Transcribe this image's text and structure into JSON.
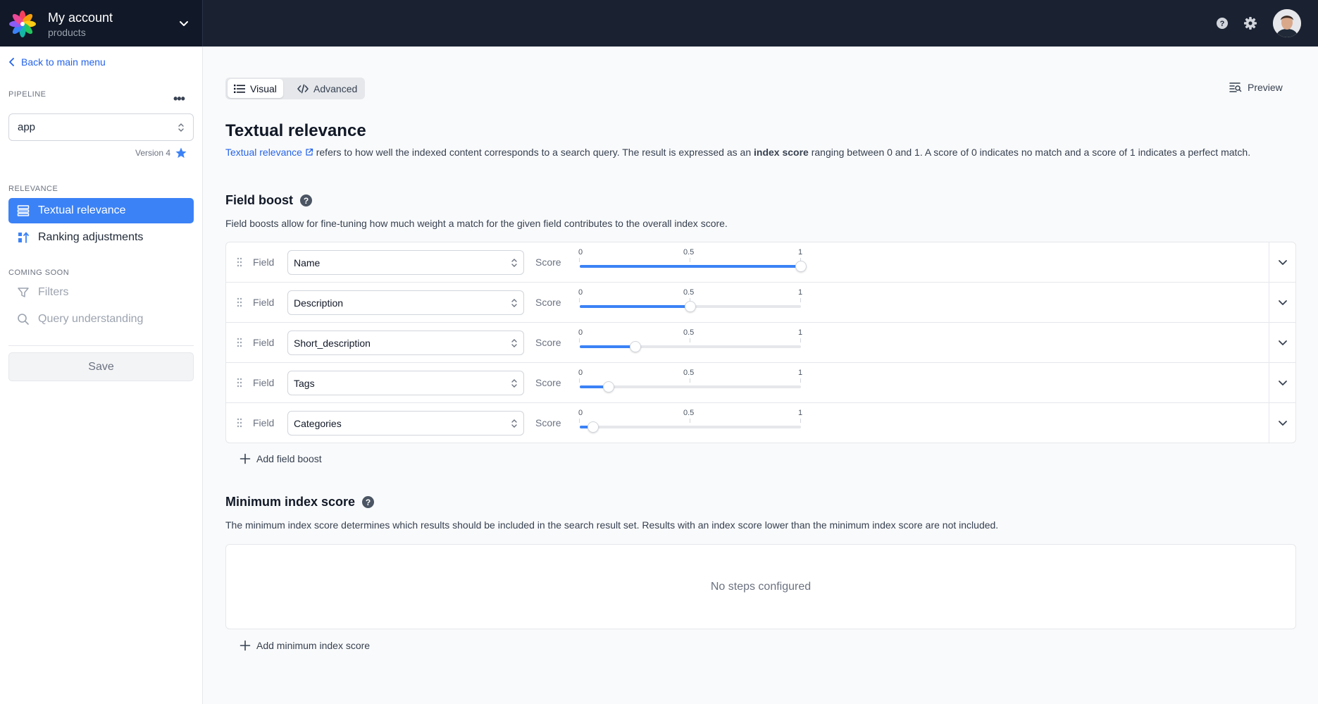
{
  "header": {
    "account_title": "My account",
    "account_subtitle": "products"
  },
  "sidebar": {
    "back_label": "Back to main menu",
    "pipeline_label": "PIPELINE",
    "pipeline_value": "app",
    "version_label": "Version 4",
    "relevance_label": "RELEVANCE",
    "relevance_items": [
      {
        "label": "Textual relevance",
        "active": true
      },
      {
        "label": "Ranking adjustments",
        "active": false
      }
    ],
    "coming_soon_label": "COMING SOON",
    "coming_soon_items": [
      {
        "label": "Filters"
      },
      {
        "label": "Query understanding"
      }
    ],
    "save_label": "Save"
  },
  "main": {
    "tabs": [
      {
        "label": "Visual",
        "active": true
      },
      {
        "label": "Advanced",
        "active": false
      }
    ],
    "preview_label": "Preview",
    "title": "Textual relevance",
    "intro": {
      "link_text": "Textual relevance",
      "text_1": "refers to how well the indexed content corresponds to a search query. The result is expressed as an",
      "bold": "index score",
      "text_2": "ranging between 0 and 1. A score of 0 indicates no match and a score of 1 indicates a perfect match."
    },
    "field_boost": {
      "heading": "Field boost",
      "description": "Field boosts allow for fine-tuning how much weight a match for the given field contributes to the overall index score.",
      "field_label": "Field",
      "score_label": "Score",
      "tick_labels": [
        "0",
        "0.5",
        "1"
      ],
      "rows": [
        {
          "field": "Name",
          "score": 1.0
        },
        {
          "field": "Description",
          "score": 0.5
        },
        {
          "field": "Short_description",
          "score": 0.25
        },
        {
          "field": "Tags",
          "score": 0.13
        },
        {
          "field": "Categories",
          "score": 0.06
        }
      ],
      "add_label": "Add field boost"
    },
    "min_score": {
      "heading": "Minimum index score",
      "description": "The minimum index score determines which results should be included in the search result set. Results with an index score lower than the minimum index score are not included.",
      "empty_text": "No steps configured",
      "add_label": "Add minimum index score"
    }
  },
  "colors": {
    "topbar": "#1a2232",
    "accent": "#3b82f6",
    "link": "#2563eb"
  }
}
